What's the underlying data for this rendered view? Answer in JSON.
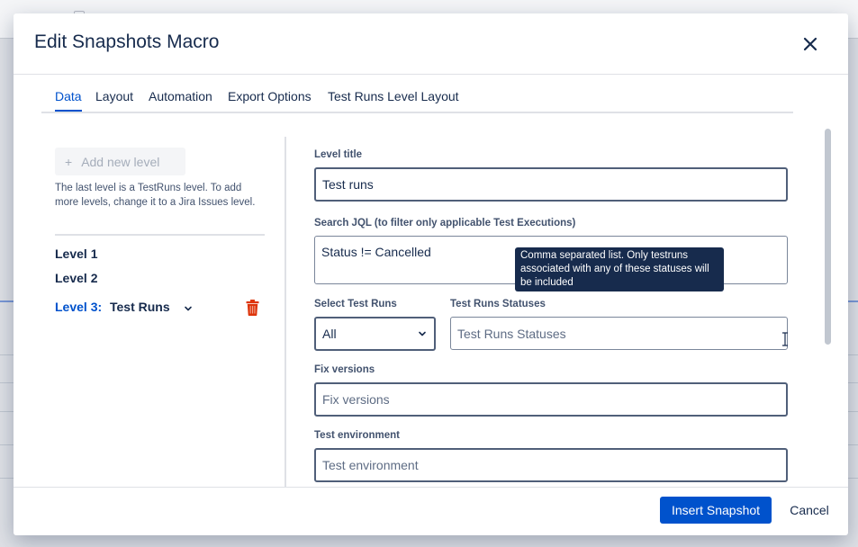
{
  "modal": {
    "title": "Edit Snapshots Macro",
    "close_icon": "close-icon"
  },
  "tabs": [
    {
      "label": "Data",
      "active": true
    },
    {
      "label": "Layout",
      "active": false
    },
    {
      "label": "Automation",
      "active": false
    },
    {
      "label": "Export Options",
      "active": false
    },
    {
      "label": "Test Runs Level Layout",
      "active": false
    }
  ],
  "levels_panel": {
    "add_button_icon": "+",
    "add_button_label": "Add new level",
    "help_text": "The last level is a TestRuns level. To add more levels, change it to a Jira Issues level.",
    "levels": [
      {
        "label": "Level 1"
      },
      {
        "label": "Level 2"
      }
    ],
    "selected_level": {
      "label": "Level 3:",
      "name": "Test Runs",
      "dropdown_icon": "chevron-down-icon",
      "delete_icon": "trash-icon"
    }
  },
  "form": {
    "level_title": {
      "label": "Level title",
      "value": "Test runs"
    },
    "search_jql": {
      "label": "Search JQL (to filter only applicable Test Executions)",
      "value": "Status != Cancelled"
    },
    "select_test_runs": {
      "label": "Select Test Runs",
      "value": "All"
    },
    "test_runs_statuses": {
      "label": "Test Runs Statuses",
      "placeholder": "Test Runs Statuses"
    },
    "fix_versions": {
      "label": "Fix versions",
      "placeholder": "Fix versions"
    },
    "test_environment": {
      "label": "Test environment",
      "placeholder": "Test environment"
    }
  },
  "tooltip": {
    "text": "Comma separated list. Only testruns associated with any of these statuses will be included"
  },
  "footer": {
    "insert_label": "Insert Snapshot",
    "cancel_label": "Cancel"
  },
  "colors": {
    "primary": "#0052cc",
    "delete": "#de350b",
    "text": "#172b4d"
  }
}
